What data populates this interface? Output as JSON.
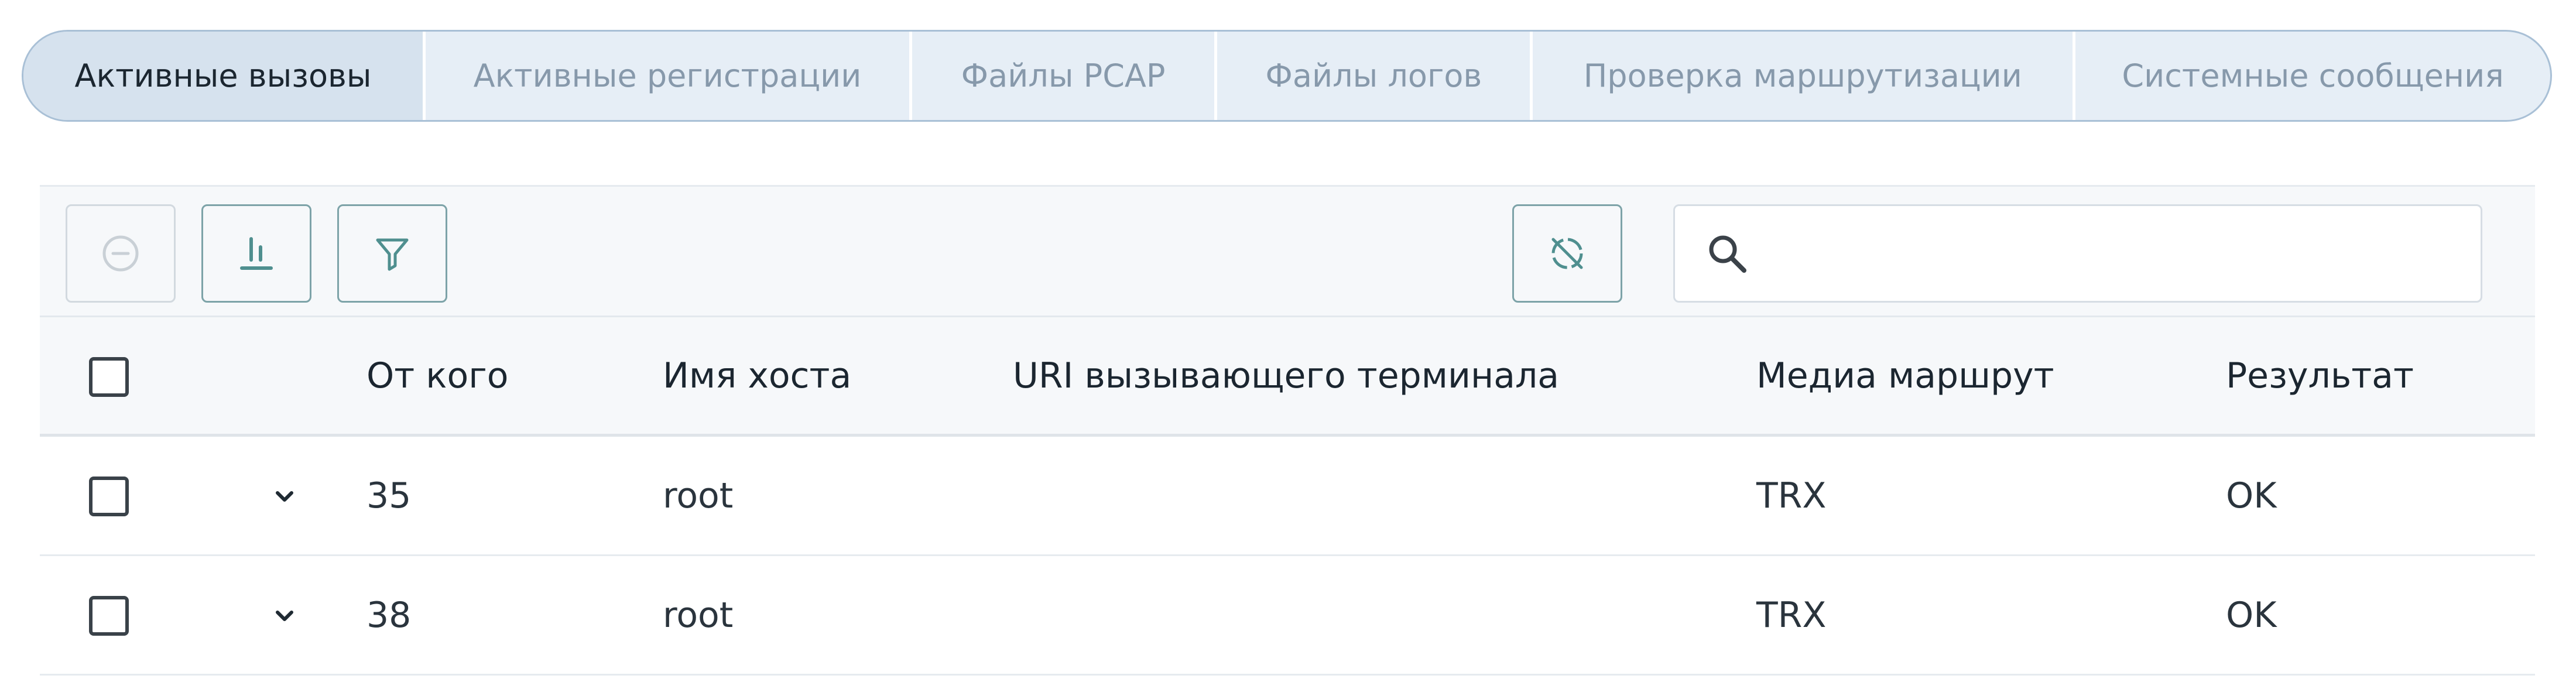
{
  "tabs": [
    {
      "label": "Активные вызовы",
      "active": true
    },
    {
      "label": "Активные регистрации",
      "active": false
    },
    {
      "label": "Файлы PCAP",
      "active": false
    },
    {
      "label": "Файлы логов",
      "active": false
    },
    {
      "label": "Проверка маршрутизации",
      "active": false
    },
    {
      "label": "Системные сообщения",
      "active": false
    }
  ],
  "toolbar": {
    "buttons": [
      {
        "name": "remove",
        "icon": "minus-circle-icon",
        "disabled": true
      },
      {
        "name": "statistics",
        "icon": "bar-chart-icon",
        "disabled": false
      },
      {
        "name": "filter",
        "icon": "filter-icon",
        "disabled": false
      },
      {
        "name": "hide-inactive",
        "icon": "visibility-off-icon",
        "disabled": false
      }
    ],
    "search": {
      "value": "",
      "placeholder": "",
      "icon": "search-icon"
    }
  },
  "table": {
    "columns": [
      "От кого",
      "Имя хоста",
      "URI вызывающего терминала",
      "Медиа маршрут",
      "Результат"
    ],
    "rows": [
      {
        "from": "35",
        "hostname": "root",
        "caller_uri": "",
        "media_route": "TRX",
        "result": "OK"
      },
      {
        "from": "38",
        "hostname": "root",
        "caller_uri": "",
        "media_route": "TRX",
        "result": "OK"
      }
    ]
  },
  "colors": {
    "tab_active_bg": "#d6e2ee",
    "tab_bg": "#e6eef6",
    "tab_border": "#a9c0d6",
    "button_border": "#7da3a8",
    "icon_accent": "#4f8f8f"
  }
}
